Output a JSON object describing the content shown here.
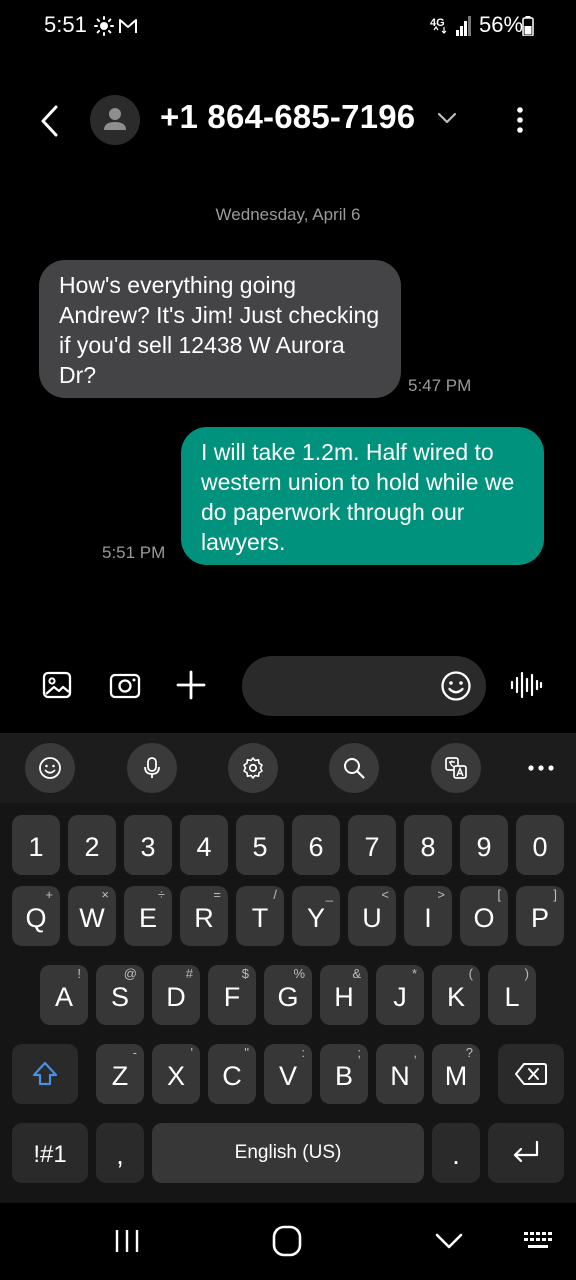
{
  "status_bar": {
    "time": "5:51",
    "icons": [
      "weather-sun-icon",
      "gmail-icon",
      "4g-lte-icon",
      "signal-icon",
      "battery-icon"
    ],
    "network": "4G",
    "battery": "56%"
  },
  "header": {
    "contact": "+1 864-685-7196",
    "icons": [
      "back-arrow-icon",
      "contact-avatar-icon",
      "chevron-down-icon",
      "more-vertical-icon"
    ]
  },
  "conversation": {
    "date": "Wednesday, April 6",
    "messages": [
      {
        "direction": "incoming",
        "text": "How's everything going Andrew? It's Jim! Just checking if you'd sell 12438 W Aurora Dr?",
        "time": "5:47 PM"
      },
      {
        "direction": "outgoing",
        "text": "I will take 1.2m. Half wired to western union to hold while we do paperwork through our lawyers.",
        "time": "5:51 PM"
      }
    ]
  },
  "compose": {
    "placeholder": "",
    "icons": [
      "gallery-icon",
      "camera-icon",
      "plus-icon",
      "emoji-icon",
      "voice-wave-icon"
    ]
  },
  "keyboard": {
    "toolbar": [
      "emoji-icon",
      "microphone-icon",
      "settings-icon",
      "search-icon",
      "translate-icon",
      "more-horizontal-icon"
    ],
    "number_row": [
      "1",
      "2",
      "3",
      "4",
      "5",
      "6",
      "7",
      "8",
      "9",
      "0"
    ],
    "row1": [
      {
        "key": "Q",
        "hint": "+"
      },
      {
        "key": "W",
        "hint": "×"
      },
      {
        "key": "E",
        "hint": "÷"
      },
      {
        "key": "R",
        "hint": "="
      },
      {
        "key": "T",
        "hint": "/"
      },
      {
        "key": "Y",
        "hint": "_"
      },
      {
        "key": "U",
        "hint": "<"
      },
      {
        "key": "I",
        "hint": ">"
      },
      {
        "key": "O",
        "hint": "["
      },
      {
        "key": "P",
        "hint": "]"
      }
    ],
    "row2": [
      {
        "key": "A",
        "hint": "!"
      },
      {
        "key": "S",
        "hint": "@"
      },
      {
        "key": "D",
        "hint": "#"
      },
      {
        "key": "F",
        "hint": "$"
      },
      {
        "key": "G",
        "hint": "%"
      },
      {
        "key": "H",
        "hint": "&"
      },
      {
        "key": "J",
        "hint": "*"
      },
      {
        "key": "K",
        "hint": "("
      },
      {
        "key": "L",
        "hint": ")"
      }
    ],
    "row3": [
      {
        "key": "Z",
        "hint": "-"
      },
      {
        "key": "X",
        "hint": "'"
      },
      {
        "key": "C",
        "hint": "\""
      },
      {
        "key": "V",
        "hint": ":"
      },
      {
        "key": "B",
        "hint": ";"
      },
      {
        "key": "N",
        "hint": ","
      },
      {
        "key": "M",
        "hint": "?"
      }
    ],
    "symbols_label": "!#1",
    "comma": ",",
    "space_label": "English (US)",
    "period": ".",
    "shift_icon": "shift-icon",
    "backspace_icon": "backspace-icon",
    "enter_icon": "enter-icon",
    "accent_color": "#4a90e2"
  },
  "navbar": {
    "icons": [
      "recents-icon",
      "home-icon",
      "hide-keyboard-icon",
      "keyboard-switch-icon"
    ]
  },
  "colors": {
    "background": "#000000",
    "incoming_bubble": "#444446",
    "outgoing_bubble": "#00927c",
    "meta_text": "#9a9a9a"
  }
}
